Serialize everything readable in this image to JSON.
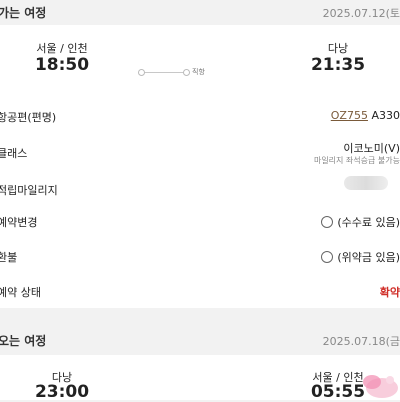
{
  "outbound": {
    "title": "가는 여정",
    "date": "2025.07.12(토",
    "departure_city": "서울 / 인천",
    "departure_time": "18:50",
    "arrival_city": "다낭",
    "arrival_time": "21:35",
    "route_label": "직항"
  },
  "details": {
    "flight_label": "항공편(편명)",
    "flight_number": "OZ755",
    "aircraft": "A330",
    "class_label": "클래스",
    "class_value": "이코노미(V)",
    "class_note": "마일리지 좌석승급 불가능",
    "mileage_label": "적립마일리지",
    "change_label": "예약변경",
    "change_value": "(수수료 있음)",
    "refund_label": "환불",
    "refund_value": "(위약금 있음)",
    "status_label": "예약 상태",
    "status_value": "확약"
  },
  "return": {
    "title": "오는 여정",
    "date": "2025.07.18(금",
    "departure_city": "다낭",
    "departure_time": "23:00",
    "arrival_city": "서울 / 인천",
    "arrival_time": "05:55"
  },
  "colors": {
    "link": "#7a5a3a",
    "status": "#d0302a",
    "sticker": "#f28bb0"
  }
}
